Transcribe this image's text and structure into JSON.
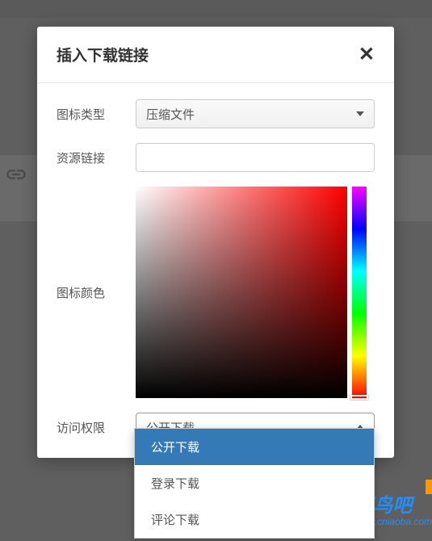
{
  "modal": {
    "title": "插入下载链接",
    "fields": {
      "icon_type": {
        "label": "图标类型",
        "selected": "压缩文件"
      },
      "resource_link": {
        "label": "资源链接",
        "value": ""
      },
      "icon_color": {
        "label": "图标颜色"
      },
      "access_permission": {
        "label": "访问权限",
        "selected": "公开下载",
        "options": [
          "公开下载",
          "登录下载",
          "评论下载"
        ]
      }
    }
  },
  "watermark": {
    "name": "莱鸟吧",
    "url": "www.cniaoba.com"
  }
}
